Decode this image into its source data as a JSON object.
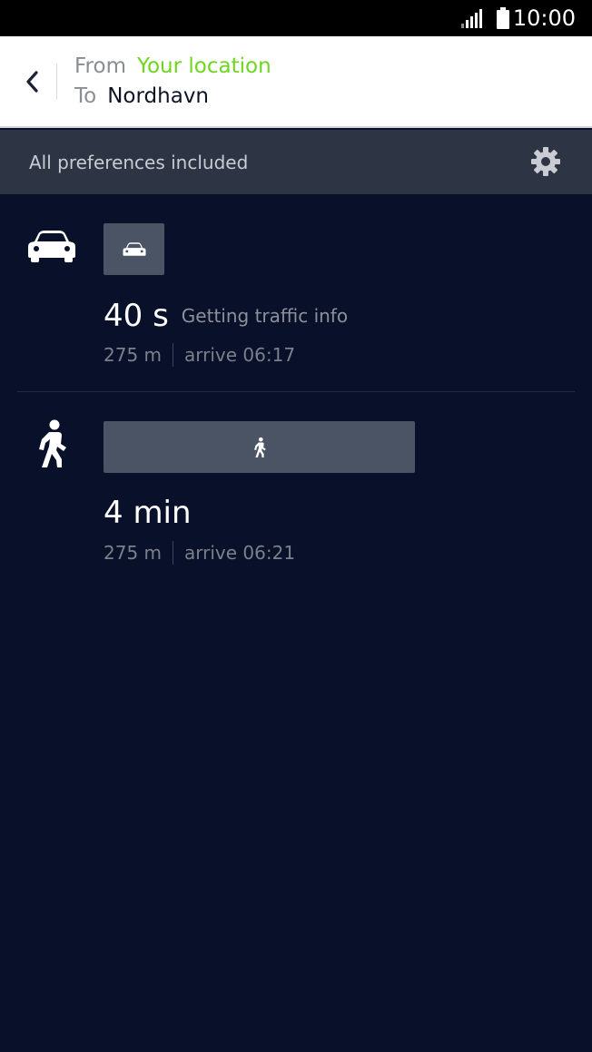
{
  "status_bar": {
    "time": "10:00",
    "icons": [
      "signal-icon",
      "battery-icon"
    ]
  },
  "header": {
    "from_label": "From",
    "from_value": "Your location",
    "to_label": "To",
    "to_value": "Nordhavn",
    "back_icon": "chevron-left-icon",
    "colors": {
      "from_value": "#6fd61e",
      "to_value": "#0d1426"
    }
  },
  "preferences": {
    "text": "All preferences included",
    "icon": "gear-icon"
  },
  "routes": [
    {
      "mode": "car",
      "icon": "car-icon",
      "duration": "40 s",
      "traffic": "Getting traffic info",
      "distance": "275 m",
      "arrive": "arrive 06:17"
    },
    {
      "mode": "walk",
      "icon": "walking-person-icon",
      "duration": "4 min",
      "distance": "275 m",
      "arrive": "arrive 06:21"
    }
  ],
  "colors": {
    "background": "#08102a",
    "prefs_bar": "#2d3444",
    "route_bar": "#4b5464"
  }
}
